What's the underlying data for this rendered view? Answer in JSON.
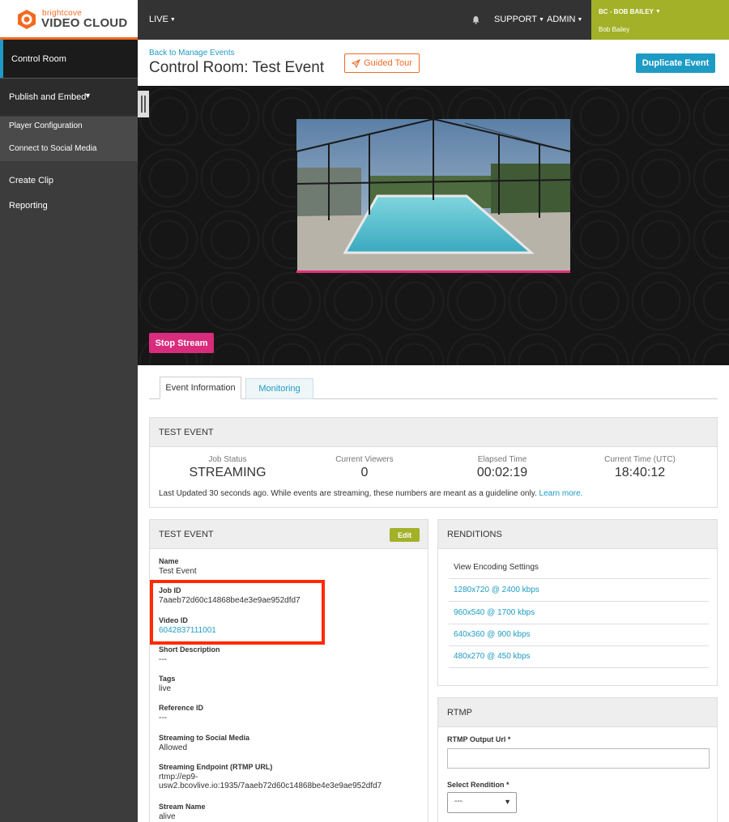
{
  "brand": {
    "small": "brightcove",
    "big": "VIDEO CLOUD",
    "accent": "#f26a22"
  },
  "topnav": {
    "live": "LIVE",
    "support": "SUPPORT",
    "admin": "ADMIN"
  },
  "user": {
    "account": "BC - BOB BAILEY",
    "name": "Bob Bailey"
  },
  "sidebar": {
    "control_room": "Control Room",
    "publish": "Publish and Embed",
    "publish_items": [
      "Player Configuration",
      "Connect to Social Media"
    ],
    "create_clip": "Create Clip",
    "reporting": "Reporting"
  },
  "header": {
    "back": "Back to Manage Events",
    "title": "Control Room: Test Event",
    "guided_tour": "Guided Tour",
    "duplicate": "Duplicate Event"
  },
  "player": {
    "stop": "Stop Stream"
  },
  "tabs": {
    "info": "Event Information",
    "monitoring": "Monitoring"
  },
  "stats": {
    "title": "TEST EVENT",
    "job_status_label": "Job Status",
    "job_status": "STREAMING",
    "viewers_label": "Current Viewers",
    "viewers": "0",
    "elapsed_label": "Elapsed Time",
    "elapsed": "00:02:19",
    "time_label": "Current Time (UTC)",
    "time": "18:40:12",
    "note": "Last Updated 30 seconds ago. While events are streaming, these numbers are meant as a guideline only.",
    "learn_more": "Learn more."
  },
  "event": {
    "title": "TEST EVENT",
    "edit": "Edit",
    "name_label": "Name",
    "name": "Test Event",
    "job_id_label": "Job ID",
    "job_id": "7aaeb72d60c14868be4e3e9ae952dfd7",
    "video_id_label": "Video ID",
    "video_id": "6042837111001",
    "short_desc_label": "Short Description",
    "short_desc": "---",
    "tags_label": "Tags",
    "tags": "live",
    "ref_id_label": "Reference ID",
    "ref_id": "---",
    "social_label": "Streaming to Social Media",
    "social": "Allowed",
    "endpoint_label": "Streaming Endpoint (RTMP URL)",
    "endpoint_1": "rtmp://ep9-",
    "endpoint_2": "usw2.bcovlive.io:1935/7aaeb72d60c14868be4e3e9ae952dfd7",
    "stream_name_label": "Stream Name",
    "stream_name": "alive"
  },
  "renditions": {
    "title": "RENDITIONS",
    "view_settings": "View Encoding Settings",
    "items": [
      "1280x720 @ 2400 kbps",
      "960x540 @ 1700 kbps",
      "640x360 @ 900 kbps",
      "480x270 @ 450 kbps"
    ]
  },
  "rtmp": {
    "title": "RTMP",
    "output_label": "RTMP Output Url *",
    "output_value": "",
    "rendition_label": "Select Rendition *",
    "rendition_value": "---"
  }
}
